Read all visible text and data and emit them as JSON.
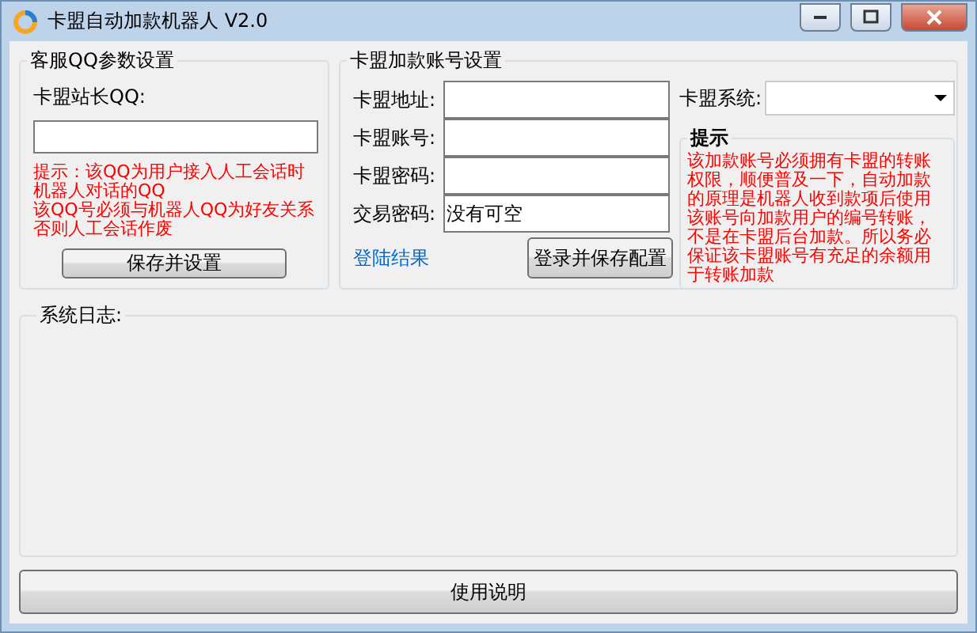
{
  "window": {
    "title": "卡盟自动加款机器人  V2.0"
  },
  "qq_group": {
    "title": "客服QQ参数设置",
    "label": "卡盟站长QQ:",
    "hint": [
      "提示：该QQ为用户接入人工会话时机器人对话的QQ",
      "该QQ号必须与机器人QQ为好友关系否则人工会话作废"
    ],
    "button": "保存并设置"
  },
  "account_group": {
    "title": "卡盟加款账号设置",
    "fields": [
      {
        "label": "卡盟地址:"
      },
      {
        "label": "卡盟账号:"
      },
      {
        "label": "卡盟密码:"
      },
      {
        "label": "交易密码:",
        "value": "没有可空"
      }
    ],
    "login_result": "登陆结果",
    "button": "登录并保存配置",
    "system_label": "卡盟系统:",
    "tip_title": "提示",
    "tip": "该加款账号必须拥有卡盟的转账权限，顺便普及一下，自动加款的原理是机器人收到款项后使用该账号向加款用户的编号转账，不是在卡盟后台加款。所以务必保证该卡盟账号有充足的余额用于转账加款"
  },
  "log_group": {
    "title": "系统日志:"
  },
  "help_button": "使用说明"
}
